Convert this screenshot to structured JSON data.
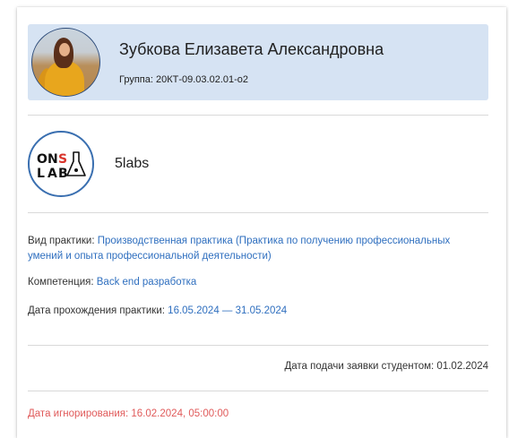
{
  "student": {
    "name": "Зубкова Елизавета Александровна",
    "group": "Группа: 20КТ-09.03.02.01-о2"
  },
  "company": {
    "name": "5labs",
    "logo_text_top": "ONS",
    "logo_text_bottom": "LAB"
  },
  "practice": {
    "type_label": "Вид практики:",
    "type_value": "Производственная практика (Практика по получению профессиональных умений и опыта профессиональной деятельности)",
    "competence_label": "Компетенция:",
    "competence_value": "Back end разработка",
    "dates_label": "Дата прохождения практики:",
    "dates_value": "16.05.2024 — 31.05.2024"
  },
  "submission": {
    "text": "Дата подачи заявки студентом: 01.02.2024"
  },
  "ignore": {
    "text": "Дата игнорирования: 16.02.2024, 05:00:00"
  },
  "colors": {
    "accent": "#2f6fbf",
    "header_bg": "#d6e3f3",
    "warning": "#e05a5a",
    "logo_red": "#d9342b"
  }
}
